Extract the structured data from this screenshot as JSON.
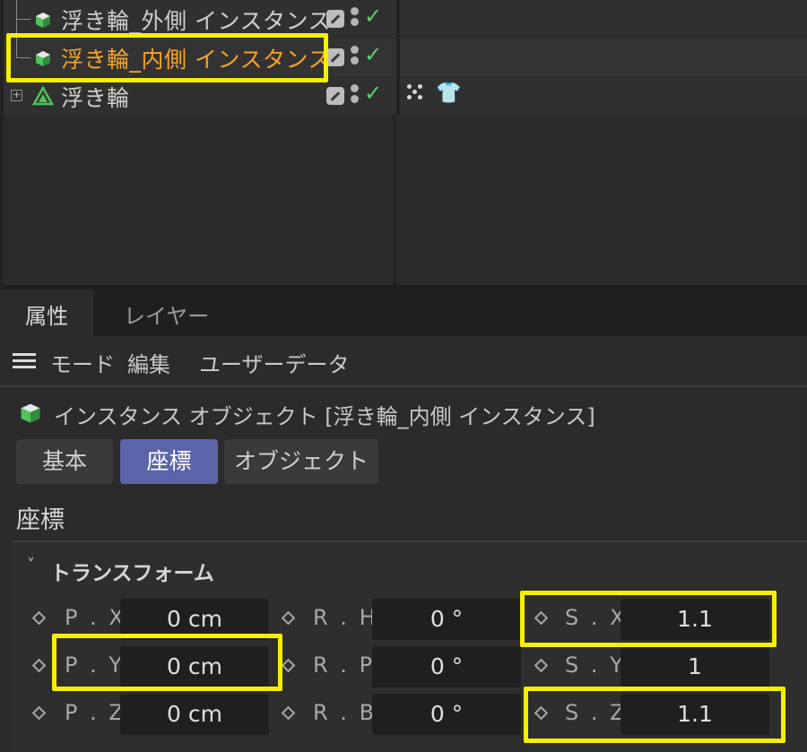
{
  "object_manager": {
    "rows": [
      {
        "name": "浮き輪_外側 インスタンス",
        "selected": false
      },
      {
        "name": "浮き輪_内側 インスタンス",
        "selected": true
      },
      {
        "name": "浮き輪",
        "selected": false
      }
    ]
  },
  "attributes": {
    "tabs": [
      "属性",
      "レイヤー"
    ],
    "menu": [
      "モード",
      "編集",
      "ユーザーデータ"
    ],
    "object_title": "インスタンス オブジェクト [浮き輪_内側 インスタンス]",
    "buttons": [
      "基本",
      "座標",
      "オブジェクト"
    ],
    "active_button": "座標",
    "section_title": "座標",
    "group_title": "トランスフォーム",
    "params": {
      "px": {
        "label": "P . X",
        "value": "0 cm"
      },
      "py": {
        "label": "P . Y",
        "value": "0 cm"
      },
      "pz": {
        "label": "P . Z",
        "value": "0 cm"
      },
      "rh": {
        "label": "R . H",
        "value": "0 °"
      },
      "rp": {
        "label": "R . P",
        "value": "0 °"
      },
      "rb": {
        "label": "R . B",
        "value": "0 °"
      },
      "sx": {
        "label": "S . X",
        "value": "1.1"
      },
      "sy": {
        "label": "S . Y",
        "value": "1"
      },
      "sz": {
        "label": "S . Z",
        "value": "1.1"
      }
    }
  },
  "colors": {
    "highlight": "#f6f000",
    "active_button": "#5b64a8",
    "selected_object": "#f4a52b",
    "check": "#5bd16a"
  }
}
